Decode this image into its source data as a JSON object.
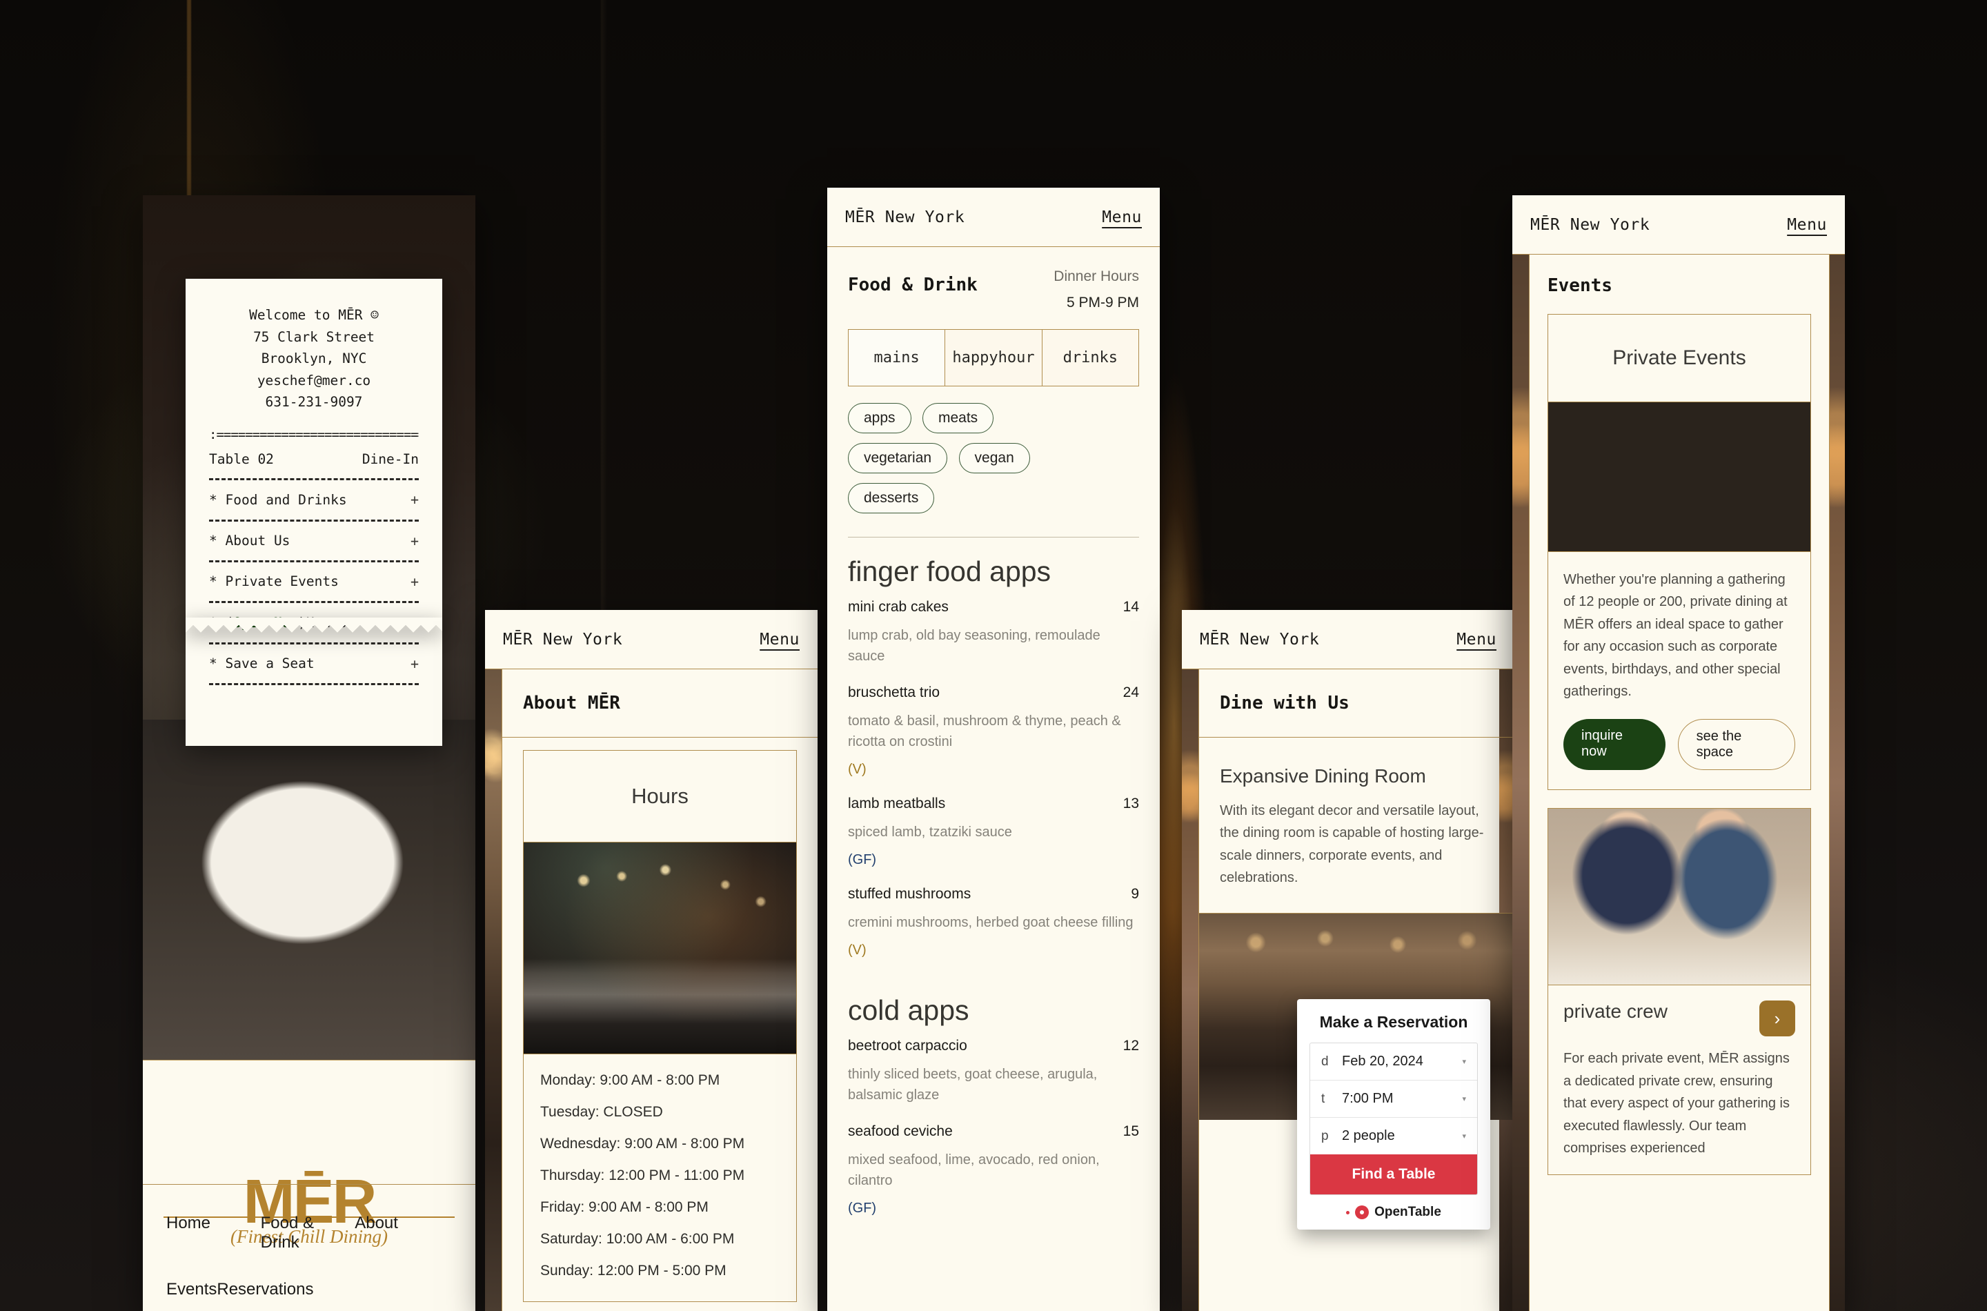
{
  "brand": {
    "name": "MĒR New York",
    "logo": "MĒR",
    "tagline": "(Finest Chill Dining)",
    "menu_label": "Menu",
    "accent_gold": "#b4832e",
    "accent_green": "#1b4214",
    "accent_red": "#da3743",
    "paper": "#fdfaef"
  },
  "screen_home": {
    "topbar_title": "MĒR New York",
    "menu_label": "Menu",
    "receipt": {
      "welcome": "Welcome to MĒR ☺",
      "street": "75 Clark Street",
      "city": "Brooklyn, NYC",
      "email": "yeschef@mer.co",
      "phone": "631-231-9097",
      "sep_equals": ":==============================:",
      "table_label": "Table 02",
      "service_type": "Dine-In",
      "items": [
        {
          "star": "*",
          "label": "Food and Drinks",
          "plus": "+"
        },
        {
          "star": "*",
          "label": "About Us",
          "plus": "+"
        },
        {
          "star": "*",
          "label": "Private Events",
          "plus": "+"
        },
        {
          "star": "*",
          "label": "Hours",
          "plus": "+",
          "prefix_open": "(",
          "open_now": "Open Now",
          "suffix_open": ")"
        },
        {
          "star": "*",
          "label": "Save a Seat",
          "plus": "+"
        }
      ]
    },
    "footer_nav": [
      "Home",
      "Food & Drink",
      "About",
      "Events",
      "Reservations"
    ]
  },
  "screen_about": {
    "topbar_title": "MĒR New York",
    "menu_label": "Menu",
    "page_title": "About MĒR",
    "hours_card_title": "Hours",
    "hours": [
      "Monday: 9:00 AM - 8:00 PM",
      "Tuesday: CLOSED",
      "Wednesday: 9:00 AM - 8:00 PM",
      "Thursday: 12:00 PM - 11:00 PM",
      "Friday: 9:00 AM - 8:00 PM",
      "Saturday: 10:00 AM - 6:00 PM",
      "Sunday: 12:00 PM - 5:00 PM"
    ]
  },
  "screen_menu": {
    "topbar_title": "MĒR New York",
    "menu_label": "Menu",
    "page_title": "Food & Drink",
    "hours_label": "Dinner Hours",
    "hours_value": "5 PM-9 PM",
    "tabs": [
      {
        "label": "mains",
        "active": true
      },
      {
        "label": "happyhour",
        "active": false
      },
      {
        "label": "drinks",
        "active": false
      }
    ],
    "chips": [
      "apps",
      "meats",
      "vegetarian",
      "vegan",
      "desserts"
    ],
    "sections": [
      {
        "title": "finger food apps",
        "items": [
          {
            "name": "mini crab cakes",
            "price": "14",
            "desc": "lump crab, old bay seasoning, remoulade sauce",
            "tag": ""
          },
          {
            "name": "bruschetta trio",
            "price": "24",
            "desc": "tomato & basil, mushroom & thyme, peach & ricotta on crostini",
            "tag": "(V)"
          },
          {
            "name": "lamb meatballs",
            "price": "13",
            "desc": "spiced lamb, tzatziki sauce",
            "tag": "(GF)"
          },
          {
            "name": "stuffed mushrooms",
            "price": "9",
            "desc": "cremini mushrooms, herbed goat cheese filling",
            "tag": "(V)"
          }
        ]
      },
      {
        "title": "cold apps",
        "items": [
          {
            "name": "beetroot carpaccio",
            "price": "12",
            "desc": "thinly sliced beets, goat cheese, arugula, balsamic glaze",
            "tag": ""
          },
          {
            "name": "seafood ceviche",
            "price": "15",
            "desc": "mixed seafood, lime, avocado, red onion, cilantro",
            "tag": "(GF)"
          }
        ]
      }
    ]
  },
  "screen_dine": {
    "topbar_title": "MĒR New York",
    "menu_label": "Menu",
    "page_title": "Dine with Us",
    "room_title": "Expansive Dining Room",
    "room_desc": "With its elegant decor and versatile layout, the dining room is capable of hosting large-scale dinners, corporate events, and celebrations.",
    "reservation": {
      "title": "Make a Reservation",
      "date_icon": "d",
      "date_value": "Feb 20, 2024",
      "time_icon": "t",
      "time_value": "7:00 PM",
      "party_icon": "p",
      "party_value": "2 people",
      "caret": "▾",
      "submit_label": "Find a Table",
      "provider": "OpenTable"
    }
  },
  "screen_events": {
    "topbar_title": "MĒR New York",
    "menu_label": "Menu",
    "page_title": "Events",
    "private_events_title": "Private Events",
    "private_events_desc": "Whether you're planning a gathering of 12 people or 200, private dining at MĒR offers an ideal space to gather for any occasion such as corporate events, birthdays, and other special gatherings.",
    "btn_primary": "inquire now",
    "btn_secondary": "see the space",
    "crew_title": "private crew",
    "crew_arrow": "›",
    "crew_desc": "For each private event, MĒR assigns a dedicated private crew, ensuring that every aspect of your gathering is executed flawlessly. Our team comprises experienced"
  }
}
